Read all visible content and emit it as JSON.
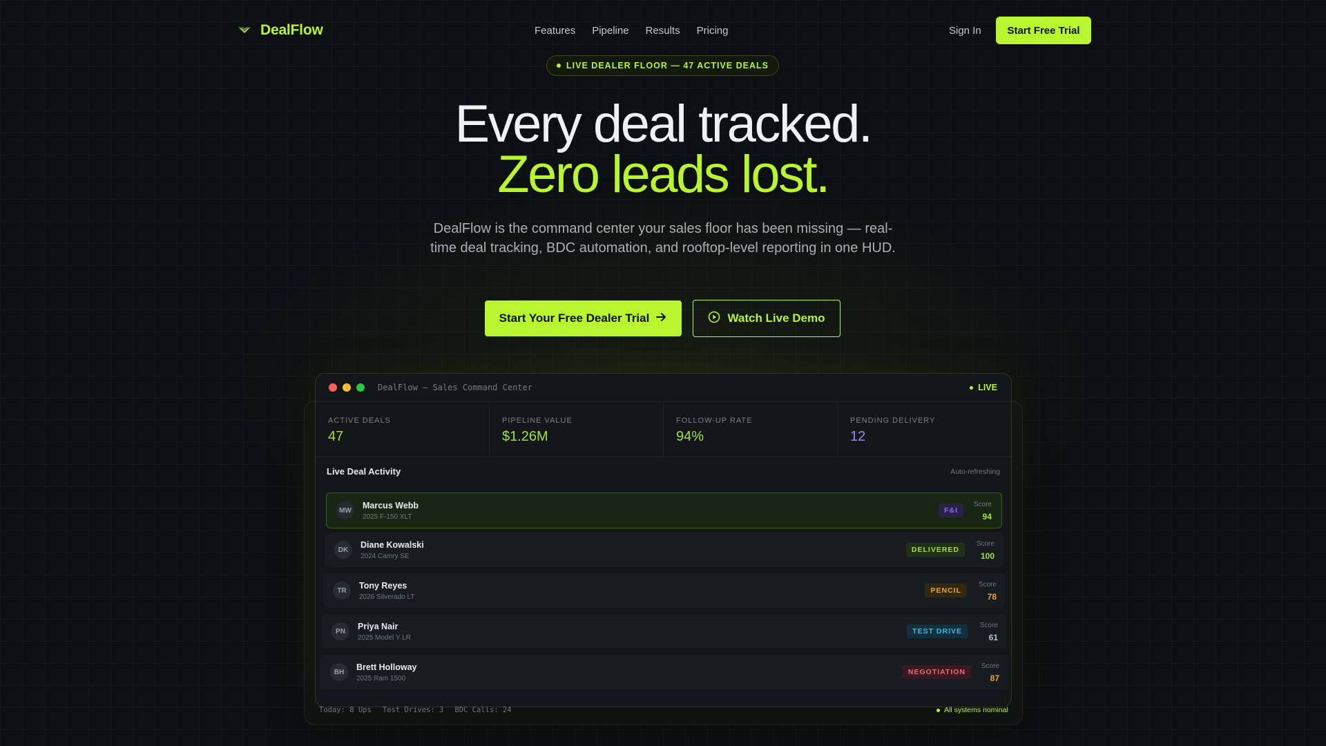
{
  "nav": {
    "brand": "DealFlow",
    "links": [
      "Features",
      "Pipeline",
      "Results",
      "Pricing"
    ],
    "sign_in": "Sign In",
    "cta": "Start Free Trial"
  },
  "hero": {
    "pill": "LIVE DEALER FLOOR — 47 ACTIVE DEALS",
    "headline_line1": "Every deal tracked.",
    "headline_line2": "Zero leads lost.",
    "subheadline": "DealFlow is the command center your sales floor has been missing — real-time deal tracking, BDC automation, and rooftop-level reporting in one HUD.",
    "primary_cta": "Start Your Free Dealer Trial",
    "secondary_cta": "Watch Live Demo"
  },
  "dashboard": {
    "window_title": "DealFlow — Sales Command Center",
    "live_label": "LIVE",
    "stats": [
      {
        "label": "ACTIVE DEALS",
        "value": "47",
        "color": "#a5e03a"
      },
      {
        "label": "PIPELINE VALUE",
        "value": "$1.26M",
        "color": "#a5e03a"
      },
      {
        "label": "FOLLOW-UP RATE",
        "value": "94%",
        "color": "#a5e03a"
      },
      {
        "label": "PENDING DELIVERY",
        "value": "12",
        "color": "#9a86e6"
      }
    ],
    "activity_title": "Live Deal Activity",
    "activity_status": "Auto-refreshing",
    "score_label": "Score",
    "deals": [
      {
        "initials": "MW",
        "name": "Marcus Webb",
        "vehicle": "2025 F-150 XLT",
        "stage": "F&I",
        "score": "94"
      },
      {
        "initials": "DK",
        "name": "Diane Kowalski",
        "vehicle": "2024 Camry SE",
        "stage": "DELIVERED",
        "score": "100"
      },
      {
        "initials": "TR",
        "name": "Tony Reyes",
        "vehicle": "2026 Silverado LT",
        "stage": "PENCIL",
        "score": "78"
      },
      {
        "initials": "PN",
        "name": "Priya Nair",
        "vehicle": "2025 Model Y LR",
        "stage": "TEST DRIVE",
        "score": "61"
      },
      {
        "initials": "BH",
        "name": "Brett Holloway",
        "vehicle": "2025 Ram 1500",
        "stage": "NEGOTIATION",
        "score": "87"
      }
    ],
    "footer": {
      "ups": "Today: 8 Ups",
      "test_drives": "Test Drives: 3",
      "bdc_calls": "BDC Calls: 24",
      "status": "All systems nominal"
    }
  },
  "colors": {
    "accent": "#b8f52f",
    "background": "#0d1012",
    "badge_fi": "#8b6cf0",
    "badge_delivered": "#a5e03a",
    "badge_pencil": "#e7a63a",
    "badge_test_drive": "#3fb6e6",
    "badge_negotiation": "#e86a7a"
  }
}
